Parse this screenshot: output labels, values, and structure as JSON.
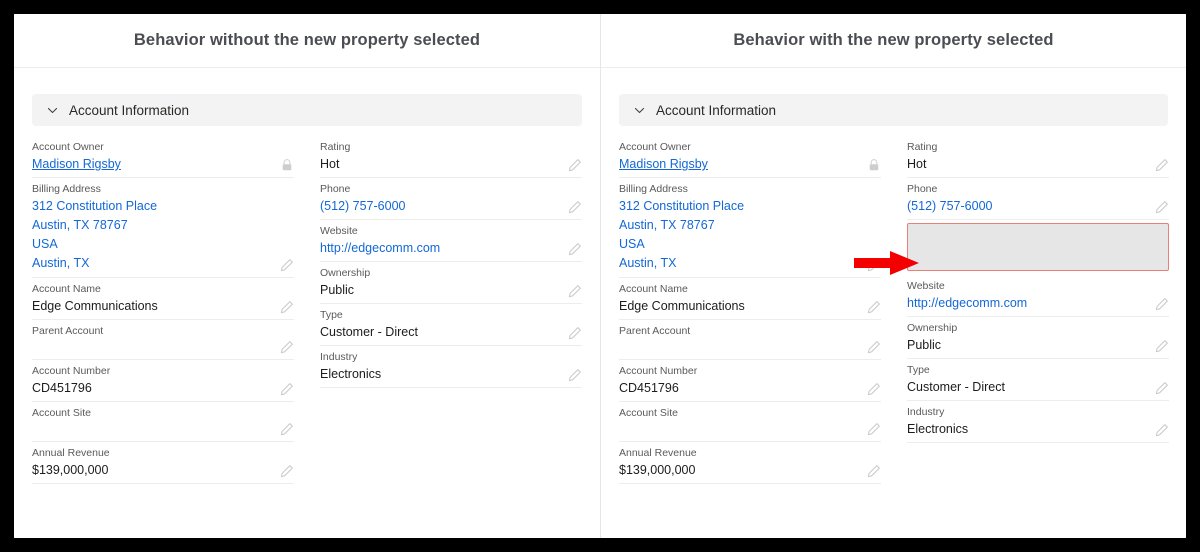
{
  "panels": [
    {
      "title": "Behavior without the new property selected",
      "section": {
        "label": "Account Information",
        "chevron_icon": "chevron-down-icon"
      },
      "left_column": [
        {
          "label": "Account Owner",
          "value": "Madison Rigsby",
          "style": "link-u",
          "action_icon": "lock-icon"
        },
        {
          "label": "Billing Address",
          "value": "312 Constitution Place\nAustin, TX 78767\nUSA\nAustin, TX",
          "style": "multi-link",
          "action_icon": "pencil-icon"
        },
        {
          "label": "Account Name",
          "value": "Edge Communications",
          "style": "text",
          "action_icon": "pencil-icon"
        },
        {
          "label": "Parent Account",
          "value": "",
          "style": "empty",
          "action_icon": "pencil-icon"
        },
        {
          "label": "Account Number",
          "value": "CD451796",
          "style": "text",
          "action_icon": "pencil-icon"
        },
        {
          "label": "Account Site",
          "value": "",
          "style": "empty",
          "action_icon": "pencil-icon"
        },
        {
          "label": "Annual Revenue",
          "value": "$139,000,000",
          "style": "text",
          "action_icon": "pencil-icon"
        }
      ],
      "right_column": [
        {
          "label": "Rating",
          "value": "Hot",
          "style": "text",
          "action_icon": "pencil-icon"
        },
        {
          "label": "Phone",
          "value": "(512) 757-6000",
          "style": "link",
          "action_icon": "pencil-icon"
        },
        {
          "label": "Website",
          "value": "http://edgecomm.com",
          "style": "link",
          "action_icon": "pencil-icon"
        },
        {
          "label": "Ownership",
          "value": "Public",
          "style": "text",
          "action_icon": "pencil-icon"
        },
        {
          "label": "Type",
          "value": "Customer - Direct",
          "style": "text",
          "action_icon": "pencil-icon"
        },
        {
          "label": "Industry",
          "value": "Electronics",
          "style": "text",
          "action_icon": "pencil-icon"
        }
      ]
    },
    {
      "title": "Behavior with the new property selected",
      "section": {
        "label": "Account Information",
        "chevron_icon": "chevron-down-icon"
      },
      "left_column": [
        {
          "label": "Account Owner",
          "value": "Madison Rigsby",
          "style": "link-u",
          "action_icon": "lock-icon"
        },
        {
          "label": "Billing Address",
          "value": "312 Constitution Place\nAustin, TX 78767\nUSA\nAustin, TX",
          "style": "multi-link",
          "action_icon": "pencil-icon"
        },
        {
          "label": "Account Name",
          "value": "Edge Communications",
          "style": "text",
          "action_icon": "pencil-icon"
        },
        {
          "label": "Parent Account",
          "value": "",
          "style": "empty",
          "action_icon": "pencil-icon"
        },
        {
          "label": "Account Number",
          "value": "CD451796",
          "style": "text",
          "action_icon": "pencil-icon"
        },
        {
          "label": "Account Site",
          "value": "",
          "style": "empty",
          "action_icon": "pencil-icon"
        },
        {
          "label": "Annual Revenue",
          "value": "$139,000,000",
          "style": "text",
          "action_icon": "pencil-icon"
        }
      ],
      "right_column": [
        {
          "label": "Rating",
          "value": "Hot",
          "style": "text",
          "action_icon": "pencil-icon"
        },
        {
          "label": "Phone",
          "value": "(512) 757-6000",
          "style": "link",
          "action_icon": "pencil-icon"
        },
        {
          "label": "",
          "value": "",
          "style": "highlight",
          "action_icon": ""
        },
        {
          "label": "Website",
          "value": "http://edgecomm.com",
          "style": "link",
          "action_icon": "pencil-icon"
        },
        {
          "label": "Ownership",
          "value": "Public",
          "style": "text",
          "action_icon": "pencil-icon"
        },
        {
          "label": "Type",
          "value": "Customer - Direct",
          "style": "text",
          "action_icon": "pencil-icon"
        },
        {
          "label": "Industry",
          "value": "Electronics",
          "style": "text",
          "action_icon": "pencil-icon"
        }
      ]
    }
  ],
  "annotation": {
    "arrow_icon": "red-right-arrow",
    "arrow_color": "#f50000",
    "highlight_border_color": "#ea7f77",
    "highlight_fill_color": "#e6e6e6"
  },
  "colors": {
    "link": "#1368d6",
    "title": "#4b4d52",
    "section_header_bg": "#f3f3f3",
    "frame": "#000000"
  }
}
